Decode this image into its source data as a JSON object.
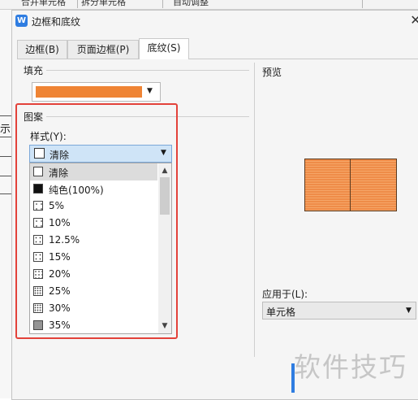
{
  "background": {
    "toolbar_items": [
      "合并单元格",
      "拆分单元格",
      "自动调整"
    ],
    "cell_text_fragment": "示"
  },
  "dialog": {
    "title": "边框和底纹",
    "close_glyph": "✕",
    "tabs": [
      {
        "label": "边框(B)",
        "active": false
      },
      {
        "label": "页面边框(P)",
        "active": false
      },
      {
        "label": "底纹(S)",
        "active": true
      }
    ],
    "fill": {
      "label": "填充",
      "color": "#ef8434"
    },
    "pattern": {
      "label": "图案",
      "style_label": "样式(Y):",
      "selected_value": "清除",
      "options": [
        {
          "label": "清除",
          "pattern": "none"
        },
        {
          "label": "纯色(100%)",
          "pattern": "solid"
        },
        {
          "label": "5%",
          "pattern": "5"
        },
        {
          "label": "10%",
          "pattern": "10"
        },
        {
          "label": "12.5%",
          "pattern": "12.5"
        },
        {
          "label": "15%",
          "pattern": "15"
        },
        {
          "label": "20%",
          "pattern": "20"
        },
        {
          "label": "25%",
          "pattern": "25"
        },
        {
          "label": "30%",
          "pattern": "30"
        },
        {
          "label": "35%",
          "pattern": "35"
        }
      ],
      "highlight_color": "#e3423a"
    },
    "preview": {
      "label": "预览",
      "fill_color": "#ef8434"
    },
    "apply_to": {
      "label": "应用于(L):",
      "value": "单元格"
    }
  },
  "watermark": "软件技巧",
  "icons": {
    "app": "wps-writer-icon",
    "dropdown": "chevron-down-icon",
    "scroll_up": "scroll-up-arrow-icon",
    "scroll_down": "scroll-down-arrow-icon"
  }
}
